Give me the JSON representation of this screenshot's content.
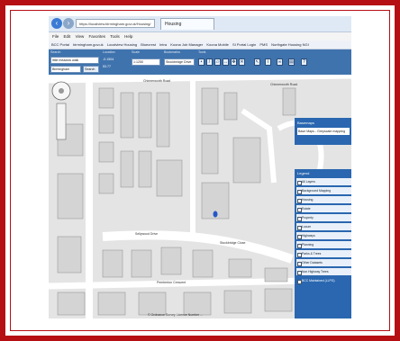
{
  "browser": {
    "address": "https://localview.birmingham.gov.uk/Housing/",
    "tab_title": "Housing",
    "menu": [
      "File",
      "Edit",
      "View",
      "Favorites",
      "Tools",
      "Help"
    ],
    "favorites": [
      "BCC Portal",
      "birmingham.gov.uk",
      "Localview Housing",
      "Bluecrest",
      "Intra",
      "Koona Job Manager",
      "Koona Mobile",
      "SI Portal Login",
      "PMS",
      "Northgate Housing NGI"
    ]
  },
  "toolbar": {
    "search_label": "Search",
    "search_value": "little meadow walk",
    "location_label": "Location",
    "scale_label": "Scale",
    "bookmarks_label": "Bookmarks",
    "tools_label": "Tools",
    "search_area": "Birmingham",
    "search_button": "Search",
    "coordinates": [
      "-0.1504",
      "53.77"
    ],
    "scale_value": "1:1250",
    "bookmark_value": "Stockbridge Drive",
    "tool_labels": [
      "Point",
      "Line",
      "Area",
      "Clear all",
      "Default",
      "Identify",
      "Link",
      "Print",
      "Help"
    ]
  },
  "map": {
    "street_labels": [
      "Chinnerworth Road",
      "Chinnerworth Road",
      "Sellywood Drive",
      "Stockbridge Close",
      "Pemberton Crescent"
    ],
    "footer": "© Ordnance Survey Licence Number ..."
  },
  "basemaps": {
    "title": "Basemaps",
    "selected": "Base Maps - Greyscale mapping"
  },
  "legend": {
    "title": "Legend",
    "items": [
      "All Layers",
      "Background Mapping",
      "Housing",
      "Estate",
      "Property",
      "Locum",
      "Highways",
      "Planning",
      "Parks & Trees",
      "Other Datasets",
      "Non Highway Trees",
      "BCC Maintained (LLPG)"
    ]
  },
  "colors": {
    "frame": "#b50f14",
    "toolbar": "#3f73ad",
    "panel": "#2a67b0",
    "marker": "#2456c8"
  }
}
